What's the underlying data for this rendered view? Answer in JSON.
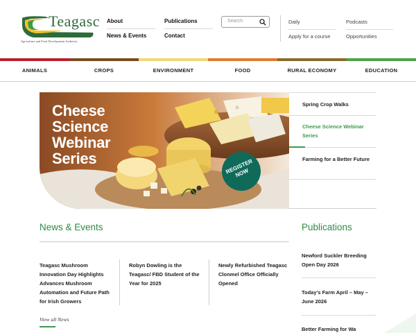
{
  "brand": {
    "wordmark": "Teagasc",
    "tagline": "Agriculture and Food Development Authority",
    "colors": {
      "green": "#2e6b3a",
      "accent": "#3d9a4a",
      "teal": "#0f6a5a"
    }
  },
  "top_nav": {
    "about": "About",
    "news_events": "News & Events",
    "publications": "Publications",
    "contact": "Contact"
  },
  "search": {
    "placeholder": "Search",
    "icon": "search-icon"
  },
  "utility_nav": {
    "daily": "Daily",
    "apply": "Apply for a course",
    "podcasts": "Podcasts",
    "opportunities": "Opportunities"
  },
  "main_nav": [
    {
      "label": "ANIMALS",
      "color": "#b81f2a"
    },
    {
      "label": "CROPS",
      "color": "#7a4a1c"
    },
    {
      "label": "ENVIRONMENT",
      "color": "#f0d77a"
    },
    {
      "label": "FOOD",
      "color": "#e07a2a"
    },
    {
      "label": "RURAL ECONOMY",
      "color": "#8a6a2a"
    },
    {
      "label": "EDUCATION",
      "color": "#4aa34a"
    }
  ],
  "hero": {
    "title": "Cheese Science Webinar Series",
    "badge": "REGISTER NOW"
  },
  "side_list": [
    {
      "label": "Spring Crop Walks",
      "active": false
    },
    {
      "label": "Cheese Science Webinar Series",
      "active": true
    },
    {
      "label": "Farming for a Better Future",
      "active": false
    }
  ],
  "news": {
    "title": "News & Events",
    "items": [
      "Teagasc Mushroom Innovation Day Highlights Advances Mushroom Automation and Future Path for Irish Growers",
      "Robyn Dowling is the Teagasc/ FBD Student of the Year for 2025",
      "Newly Refurbished Teagasc Clonmel Office Officially Opened"
    ],
    "view_all": "View all News"
  },
  "publications": {
    "title": "Publications",
    "items": [
      "Newford Suckler Breeding Open Day 2026",
      "Today's Farm April – May – June 2026",
      "Better Farming for Wa"
    ]
  }
}
